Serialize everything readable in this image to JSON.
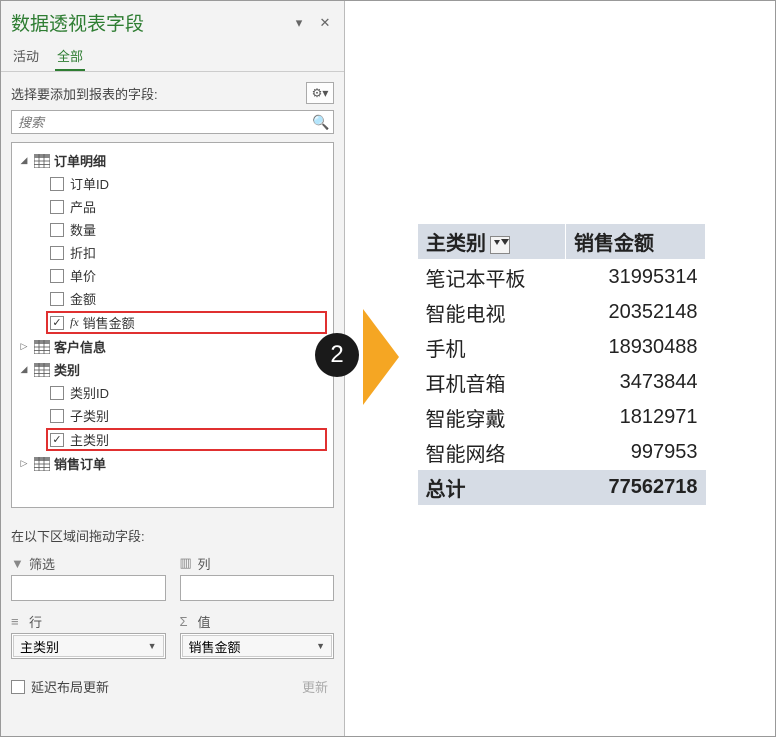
{
  "header": {
    "title": "数据透视表字段"
  },
  "tabs": {
    "active_label": "活动",
    "all_label": "全部"
  },
  "instruction": "选择要添加到报表的字段:",
  "search": {
    "placeholder": "搜索"
  },
  "tables": [
    {
      "name": "订单明细",
      "expanded": true,
      "fields": [
        {
          "label": "订单ID",
          "checked": false,
          "highlighted": false
        },
        {
          "label": "产品",
          "checked": false,
          "highlighted": false
        },
        {
          "label": "数量",
          "checked": false,
          "highlighted": false
        },
        {
          "label": "折扣",
          "checked": false,
          "highlighted": false
        },
        {
          "label": "单价",
          "checked": false,
          "highlighted": false
        },
        {
          "label": "金额",
          "checked": false,
          "highlighted": false
        },
        {
          "label": "销售金额",
          "checked": true,
          "highlighted": true,
          "fx": true
        }
      ]
    },
    {
      "name": "客户信息",
      "expanded": false,
      "fields": []
    },
    {
      "name": "类别",
      "expanded": true,
      "fields": [
        {
          "label": "类别ID",
          "checked": false,
          "highlighted": false
        },
        {
          "label": "子类别",
          "checked": false,
          "highlighted": false
        },
        {
          "label": "主类别",
          "checked": true,
          "highlighted": true
        }
      ]
    },
    {
      "name": "销售订单",
      "expanded": false,
      "fields": []
    }
  ],
  "drag_instruction": "在以下区域间拖动字段:",
  "zones": {
    "filter": {
      "label": "筛选",
      "value": ""
    },
    "columns": {
      "label": "列",
      "value": ""
    },
    "rows": {
      "label": "行",
      "value": "主类别"
    },
    "values": {
      "label": "值",
      "value": "销售金额"
    }
  },
  "footer": {
    "defer_label": "延迟布局更新",
    "update_label": "更新"
  },
  "step": "2",
  "pivot": {
    "col1_header": "主类别",
    "col2_header": "销售金额",
    "rows": [
      {
        "cat": "笔记本平板",
        "val": "31995314"
      },
      {
        "cat": "智能电视",
        "val": "20352148"
      },
      {
        "cat": "手机",
        "val": "18930488"
      },
      {
        "cat": "耳机音箱",
        "val": "3473844"
      },
      {
        "cat": "智能穿戴",
        "val": "1812971"
      },
      {
        "cat": "智能网络",
        "val": "997953"
      }
    ],
    "total_label": "总计",
    "total_value": "77562718"
  }
}
